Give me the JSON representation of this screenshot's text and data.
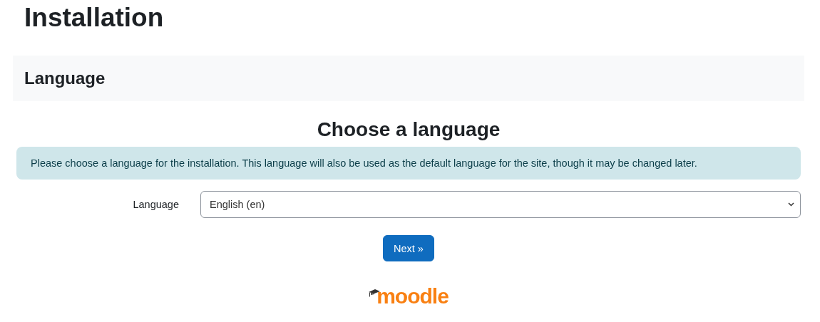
{
  "page_title": "Installation",
  "section": {
    "title": "Language"
  },
  "heading": "Choose a language",
  "notice": "Please choose a language for the installation. This language will also be used as the default language for the site, though it may be changed later.",
  "language_field": {
    "label": "Language",
    "value": "English (en)"
  },
  "next_button": "Next »",
  "logo_text": "moodle"
}
